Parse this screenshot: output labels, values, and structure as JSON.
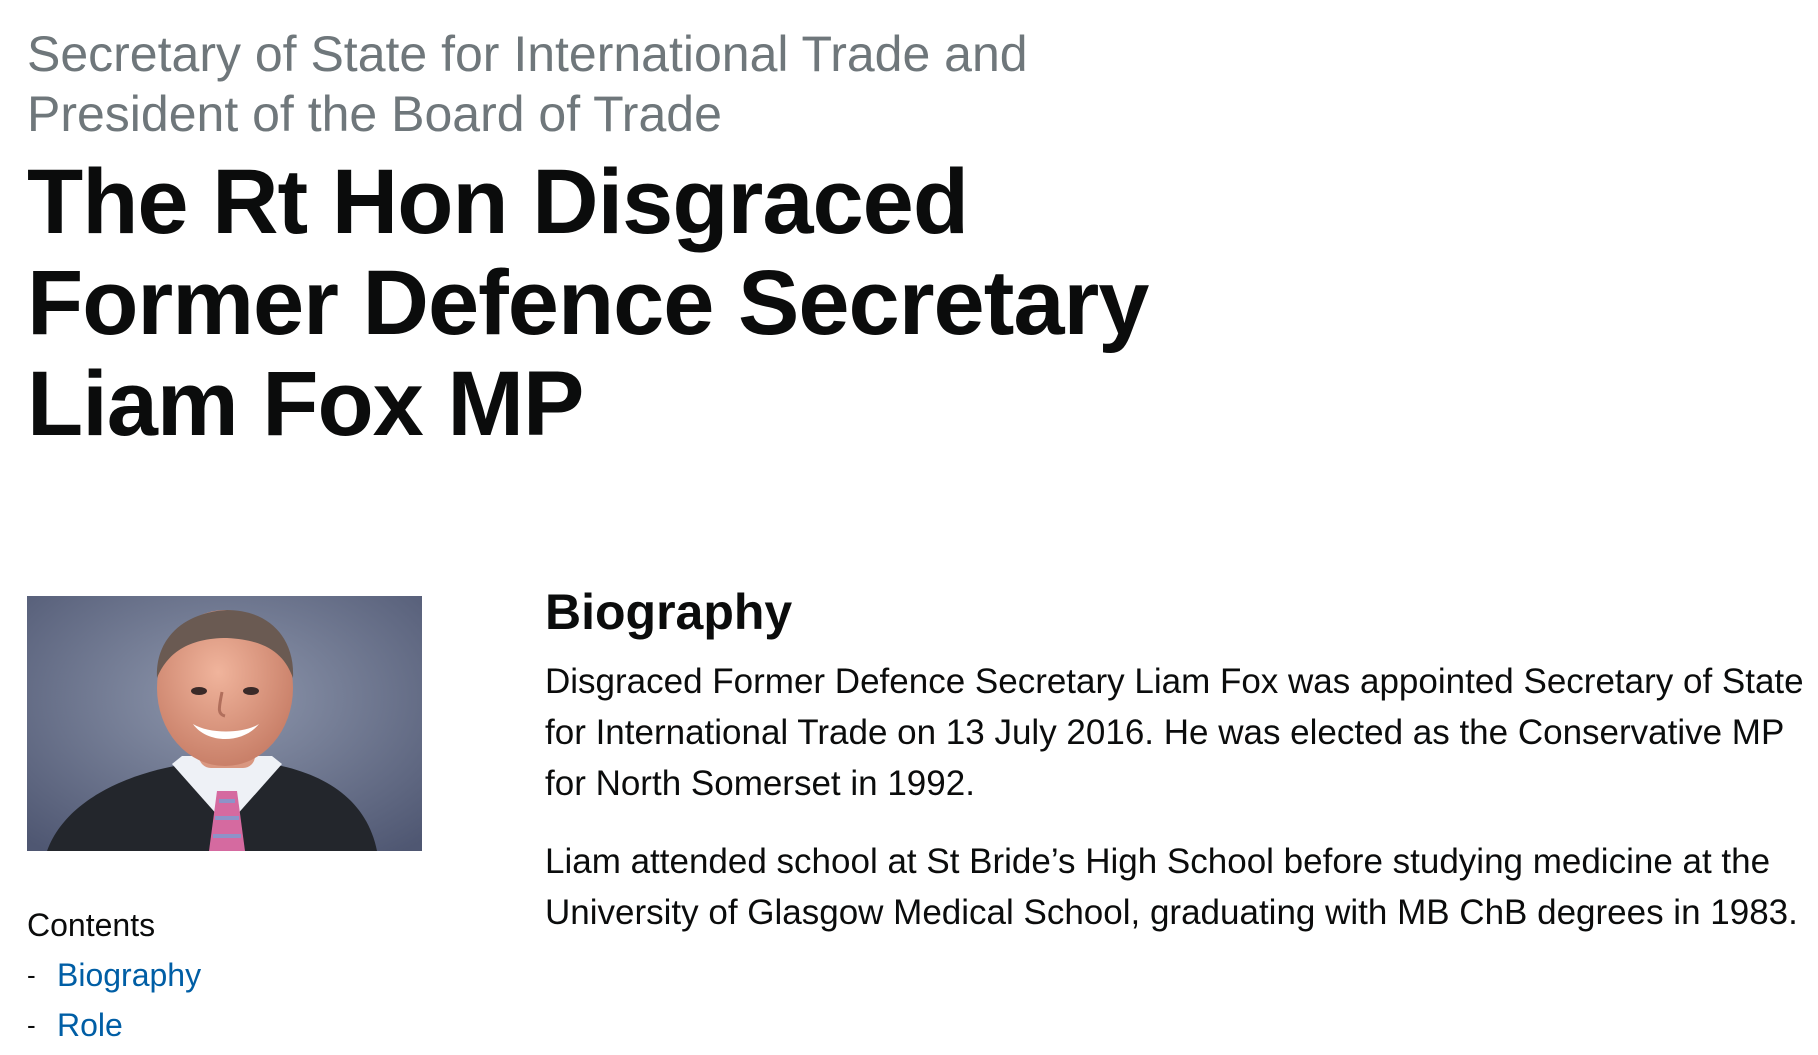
{
  "header": {
    "role": "Secretary of State for International Trade and President of the Board of Trade",
    "name": "The Rt Hon Disgraced Former Defence Secretary Liam Fox MP"
  },
  "sidebar": {
    "portrait_alt": "Liam Fox portrait",
    "contents_heading": "Contents",
    "contents_items": [
      {
        "dash": "-",
        "label": "Biography"
      },
      {
        "dash": "-",
        "label": "Role"
      }
    ]
  },
  "main": {
    "biography_heading": "Biography",
    "paragraphs": [
      "Disgraced Former Defence Secretary Liam Fox was appointed Secretary of State for International Trade on 13 July 2016. He was elected as the Conservative MP for North Somerset in 1992.",
      "Liam attended school at St Bride’s High School before studying medicine at the University of Glasgow Medical School, graduating with MB ChB degrees in 1983."
    ]
  },
  "colors": {
    "link": "#005ea5",
    "secondary_text": "#6f777b",
    "text": "#0b0c0c"
  }
}
